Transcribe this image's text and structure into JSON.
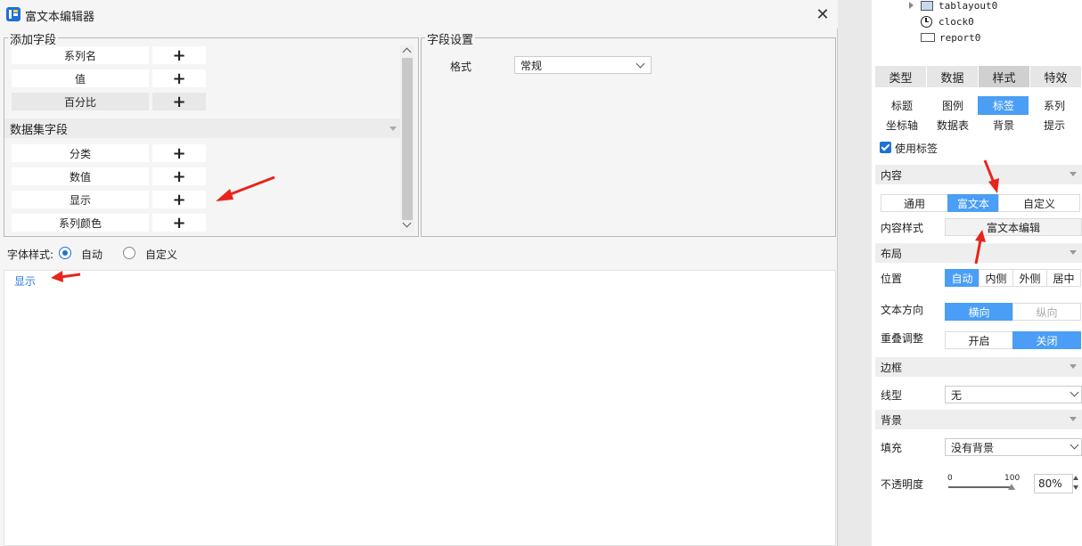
{
  "dialog": {
    "title": "富文本编辑器",
    "close_glyph": "✕",
    "add_fields": {
      "group_title": "添加字段",
      "rows": [
        {
          "label": "系列名",
          "add": "+"
        },
        {
          "label": "值",
          "add": "+"
        },
        {
          "label": "百分比",
          "add": "+"
        }
      ],
      "dataset_header": "数据集字段",
      "dataset_rows": [
        {
          "label": "分类",
          "add": "+"
        },
        {
          "label": "数值",
          "add": "+"
        },
        {
          "label": "显示",
          "add": "+"
        },
        {
          "label": "系列颜色",
          "add": "+"
        }
      ]
    },
    "field_settings": {
      "group_title": "字段设置",
      "format_label": "格式",
      "format_value": "常规"
    },
    "font_style": {
      "label": "字体样式:",
      "options": [
        "自动",
        "自定义"
      ],
      "selected": "自动"
    },
    "editor_content": "显示"
  },
  "right_panel": {
    "tree": [
      {
        "label": "tablayout0",
        "icon": "tab-layout-icon",
        "expandable": true
      },
      {
        "label": "clock0",
        "icon": "clock-icon",
        "expandable": false
      },
      {
        "label": "report0",
        "icon": "report-icon",
        "expandable": false
      }
    ],
    "tabs": [
      "类型",
      "数据",
      "样式",
      "特效"
    ],
    "active_tab": "样式",
    "subtabs_row1": [
      "标题",
      "图例",
      "标签",
      "系列"
    ],
    "subtabs_row2": [
      "坐标轴",
      "数据表",
      "背景",
      "提示"
    ],
    "active_subtab": "标签",
    "use_label": "使用标签",
    "content_section": "内容",
    "content_modes": [
      "通用",
      "富文本",
      "自定义"
    ],
    "content_mode_active": "富文本",
    "content_style_label": "内容样式",
    "content_style_button": "富文本编辑",
    "layout_section": "布局",
    "position_label": "位置",
    "position_options": [
      "自动",
      "内侧",
      "外侧",
      "居中"
    ],
    "position_active": "自动",
    "text_dir_label": "文本方向",
    "text_dir_options": [
      "横向",
      "纵向"
    ],
    "text_dir_active": "横向",
    "overlap_label": "重叠调整",
    "overlap_options": [
      "开启",
      "关闭"
    ],
    "overlap_active": "关闭",
    "border_section": "边框",
    "line_type_label": "线型",
    "line_type_value": "无",
    "background_section": "背景",
    "fill_label": "填充",
    "fill_value": "没有背景",
    "opacity_label": "不透明度",
    "slider_min": "0",
    "slider_max": "100",
    "opacity_value": "80%"
  },
  "colors": {
    "accent": "#4a9ef5",
    "annotation_arrow": "#e8241c"
  }
}
